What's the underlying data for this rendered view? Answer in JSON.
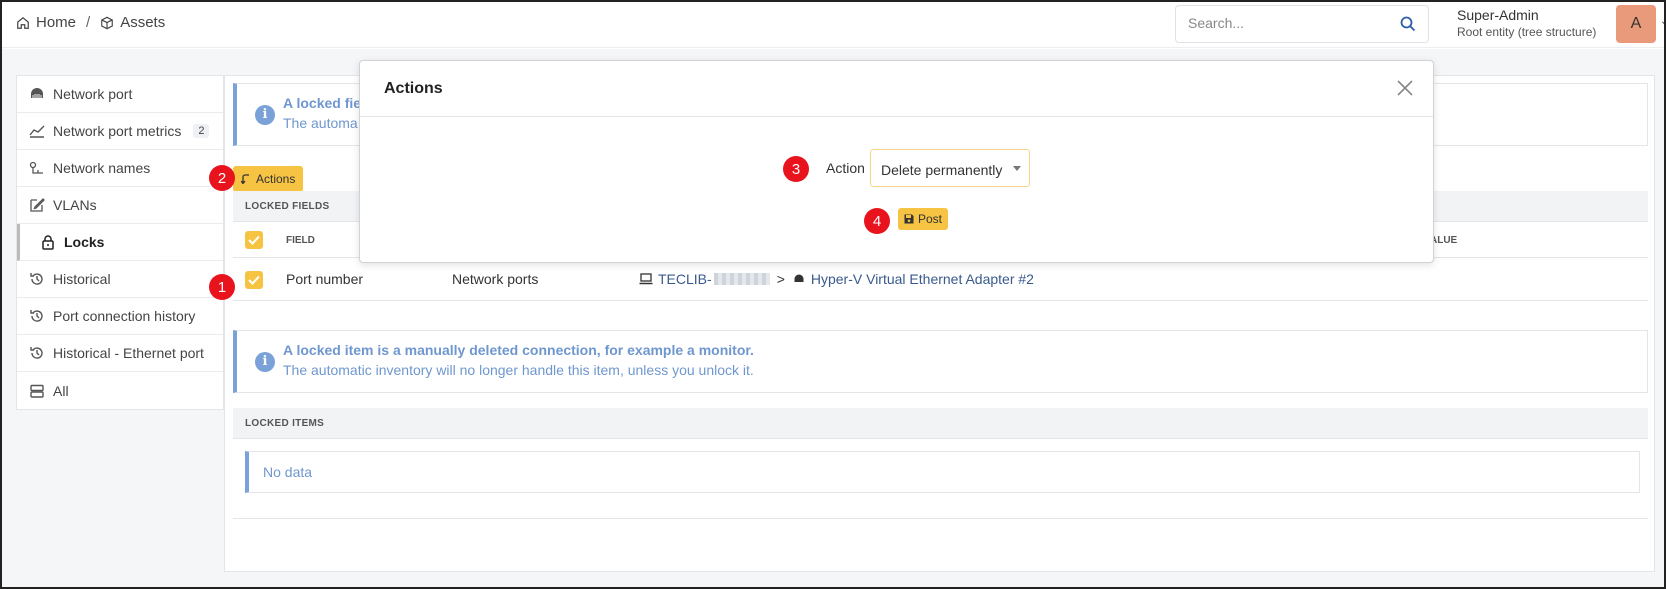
{
  "breadcrumb": {
    "home": "Home",
    "sep": "/",
    "assets": "Assets"
  },
  "search": {
    "placeholder": "Search..."
  },
  "user": {
    "name": "Super-Admin",
    "entity": "Root entity (tree structure)",
    "avatar_letter": "A"
  },
  "sidebar": {
    "items": [
      {
        "label": "Network port",
        "icon": "network-port-icon"
      },
      {
        "label": "Network port metrics",
        "badge": "2",
        "icon": "chart-line-icon"
      },
      {
        "label": "Network names",
        "icon": "network-names-icon"
      },
      {
        "label": "VLANs",
        "icon": "edit-icon"
      },
      {
        "label": "Locks",
        "icon": "lock-icon",
        "active": true
      },
      {
        "label": "Historical",
        "icon": "history-icon"
      },
      {
        "label": "Port connection history",
        "icon": "history-icon"
      },
      {
        "label": "Historical - Ethernet port",
        "icon": "history-icon"
      },
      {
        "label": "All",
        "icon": "stack-icon"
      }
    ]
  },
  "alert_top": {
    "title": "A locked fie",
    "text": "The automa"
  },
  "actions_button": {
    "label": "Actions"
  },
  "locked_fields": {
    "header": "LOCKED FIELDS",
    "col_field": "FIELD",
    "col_value": "ALUE",
    "row": {
      "field": "Port number",
      "type": "Network ports",
      "item_prefix": "TECLIB-",
      "item_link": "Hyper-V Virtual Ethernet Adapter #2"
    }
  },
  "alert_bottom": {
    "title": "A locked item is a manually deleted connection, for example a monitor.",
    "text": "The automatic inventory will no longer handle this item, unless you unlock it."
  },
  "locked_items": {
    "header": "LOCKED ITEMS",
    "empty": "No data"
  },
  "modal": {
    "title": "Actions",
    "action_label": "Action",
    "action_value": "Delete permanently",
    "post_label": "Post"
  },
  "steps": [
    "1",
    "2",
    "3",
    "4"
  ],
  "colors": {
    "accent": "#f6c343",
    "info": "#6f97cf",
    "step": "#e8131c"
  }
}
